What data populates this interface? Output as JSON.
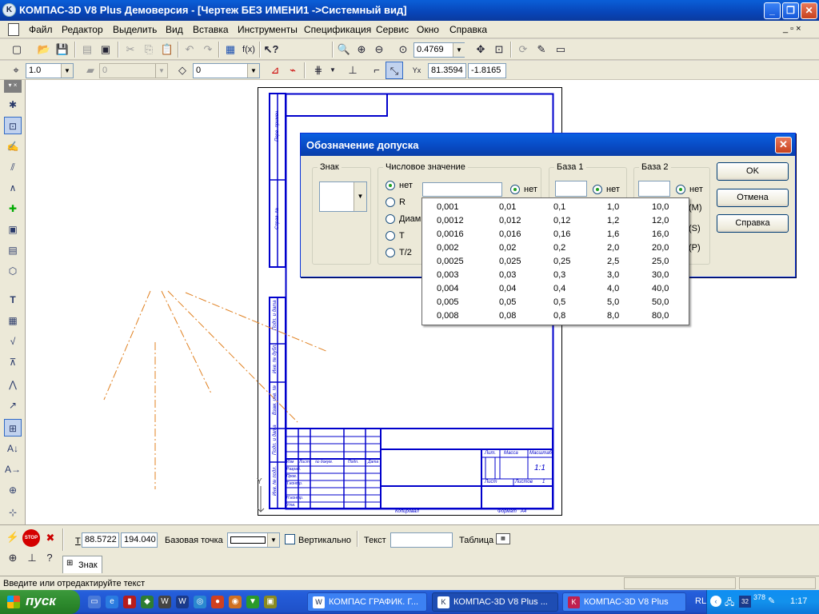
{
  "window": {
    "title": "КОМПАС-3D V8 Plus Демоверсия - [Чертеж БЕЗ ИМЕНИ1 ->Системный вид]",
    "minimize": "_",
    "maximize": "❐",
    "close": "✕"
  },
  "menu": {
    "items": [
      "Файл",
      "Редактор",
      "Выделить",
      "Вид",
      "Вставка",
      "Инструменты",
      "Спецификация",
      "Сервис",
      "Окно",
      "Справка"
    ],
    "mdi_controls": "_ ▫ ×"
  },
  "toolbar1": {
    "zoom_value": "0.4769",
    "fx_label": "f(x)"
  },
  "toolbar2": {
    "scale_value": "1.0",
    "style_value": "0",
    "layer_value": "0",
    "coord_x": "81.3594",
    "coord_y": "-1.8165",
    "coord_label": "Y"
  },
  "drawing": {
    "stamp_labels": [
      "Изм",
      "Лист",
      "№ докум.",
      "Подп.",
      "Дата",
      "Разраб.",
      "Пров.",
      "Т.контр.",
      "Н.контр.",
      "Утв.",
      "Лит.",
      "Масса",
      "Масштаб",
      "Лист",
      "Листов",
      "1"
    ],
    "scale_text": "1:1",
    "copied_label": "Копировал",
    "format_label": "Формат   А4",
    "side_labels": [
      "Перв. примен.",
      "Справ. №",
      "Подп. и дата",
      "Инв. № дубл.",
      "Взам. инв. №",
      "Подп. и дата",
      "Инв. № подл."
    ],
    "axis_y": "Y"
  },
  "dialog": {
    "title": "Обозначение допуска",
    "close": "✕",
    "sign_group": "Знак",
    "numeric_group": "Числовое значение",
    "numeric_options": [
      "нет",
      "R",
      "Диам",
      "T",
      "T/2"
    ],
    "numeric_none": "нет",
    "base1_group": "База 1",
    "base1_none": "нет",
    "base2_group": "База 2",
    "base2_none": "нет",
    "modifiers": [
      "(M)",
      "(S)",
      "(P)"
    ],
    "ok_button": "OK",
    "cancel_button": "Отмена",
    "help_button": "Справка"
  },
  "tolerance_values": [
    [
      "0,001",
      "0,01",
      "0,1",
      "1,0",
      "10,0"
    ],
    [
      "0,0012",
      "0,012",
      "0,12",
      "1,2",
      "12,0"
    ],
    [
      "0,0016",
      "0,016",
      "0,16",
      "1,6",
      "16,0"
    ],
    [
      "0,002",
      "0,02",
      "0,2",
      "2,0",
      "20,0"
    ],
    [
      "0,0025",
      "0,025",
      "0,25",
      "2,5",
      "25,0"
    ],
    [
      "0,003",
      "0,03",
      "0,3",
      "3,0",
      "30,0"
    ],
    [
      "0,004",
      "0,04",
      "0,4",
      "4,0",
      "40,0"
    ],
    [
      "0,005",
      "0,05",
      "0,5",
      "5,0",
      "50,0"
    ],
    [
      "0,008",
      "0,08",
      "0,8",
      "8,0",
      "80,0"
    ]
  ],
  "propbar": {
    "t_label": "T",
    "coord_x": "88.5722",
    "coord_y": "194.040",
    "base_point_label": "Базовая точка",
    "vertical_label": "Вертикально",
    "text_label": "Текст",
    "table_label": "Таблица",
    "tab_label": "Знак"
  },
  "status": {
    "message": "Введите или отредактируйте текст"
  },
  "taskbar": {
    "start_label": "пуск",
    "tasks": [
      "КОМПАС ГРАФИК. Г...",
      "КОМПАС-3D V8 Plus ...",
      "КОМПАС-3D V8  Plus"
    ],
    "tray_lang": "RL",
    "tray_num": "378",
    "clock": "1:17"
  },
  "colors": {
    "drawing_blue": "#0000cc",
    "construction_orange": "#e08020",
    "xp_blue": "#0a5fd8"
  }
}
